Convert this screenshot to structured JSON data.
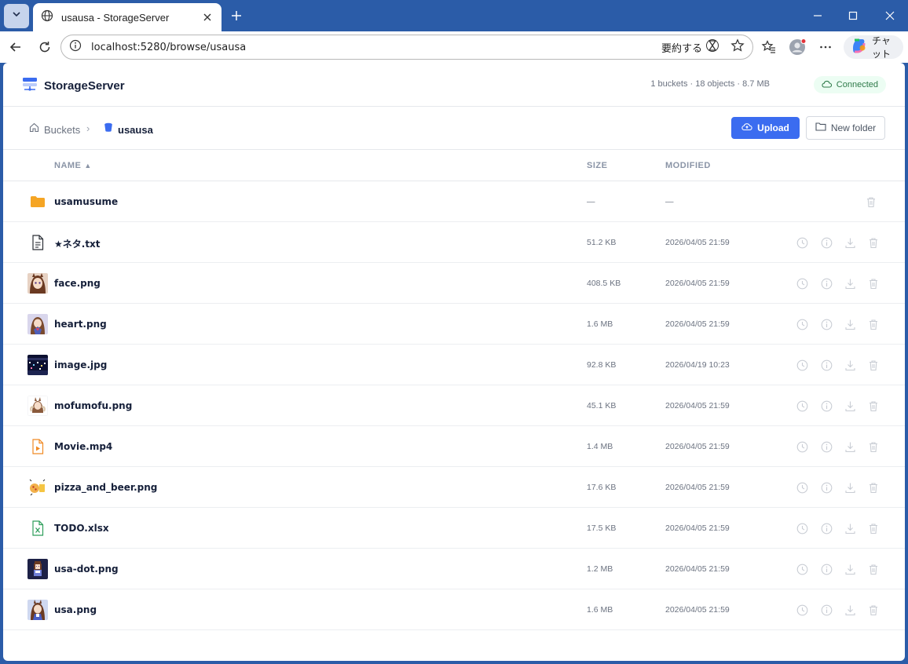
{
  "browser": {
    "tab_title": "usausa - StorageServer",
    "url": "localhost:5280/browse/usausa",
    "summarize_label": "要約する",
    "chat_label": "チャット"
  },
  "app": {
    "name": "StorageServer",
    "stats": "1 buckets · 18 objects · 8.7 MB",
    "status": "Connected"
  },
  "breadcrumb": {
    "root": "Buckets",
    "separator": "›",
    "current": "usausa"
  },
  "actions": {
    "upload": "Upload",
    "new_folder": "New folder"
  },
  "table": {
    "headers": {
      "name": "NAME",
      "sort": "▲",
      "size": "SIZE",
      "modified": "MODIFIED"
    },
    "rows": [
      {
        "name": "usamusume",
        "size": "—",
        "modified": "—",
        "kind": "folder"
      },
      {
        "name": "★ネタ.txt",
        "size": "51.2 KB",
        "modified": "2026/04/05 21:59",
        "kind": "text"
      },
      {
        "name": "face.png",
        "size": "408.5 KB",
        "modified": "2026/04/05 21:59",
        "kind": "image"
      },
      {
        "name": "heart.png",
        "size": "1.6 MB",
        "modified": "2026/04/05 21:59",
        "kind": "image"
      },
      {
        "name": "image.jpg",
        "size": "92.8 KB",
        "modified": "2026/04/19 10:23",
        "kind": "image"
      },
      {
        "name": "mofumofu.png",
        "size": "45.1 KB",
        "modified": "2026/04/05 21:59",
        "kind": "image"
      },
      {
        "name": "Movie.mp4",
        "size": "1.4 MB",
        "modified": "2026/04/05 21:59",
        "kind": "video"
      },
      {
        "name": "pizza_and_beer.png",
        "size": "17.6 KB",
        "modified": "2026/04/05 21:59",
        "kind": "image"
      },
      {
        "name": "TODO.xlsx",
        "size": "17.5 KB",
        "modified": "2026/04/05 21:59",
        "kind": "spreadsheet"
      },
      {
        "name": "usa-dot.png",
        "size": "1.2 MB",
        "modified": "2026/04/05 21:59",
        "kind": "image"
      },
      {
        "name": "usa.png",
        "size": "1.6 MB",
        "modified": "2026/04/05 21:59",
        "kind": "image"
      }
    ]
  },
  "colors": {
    "accent": "#3b6cf0",
    "titlebar": "#2b5ca8",
    "connected_bg": "#ecfdf3",
    "connected_text": "#2f7a4a",
    "folder": "#f5a524"
  }
}
